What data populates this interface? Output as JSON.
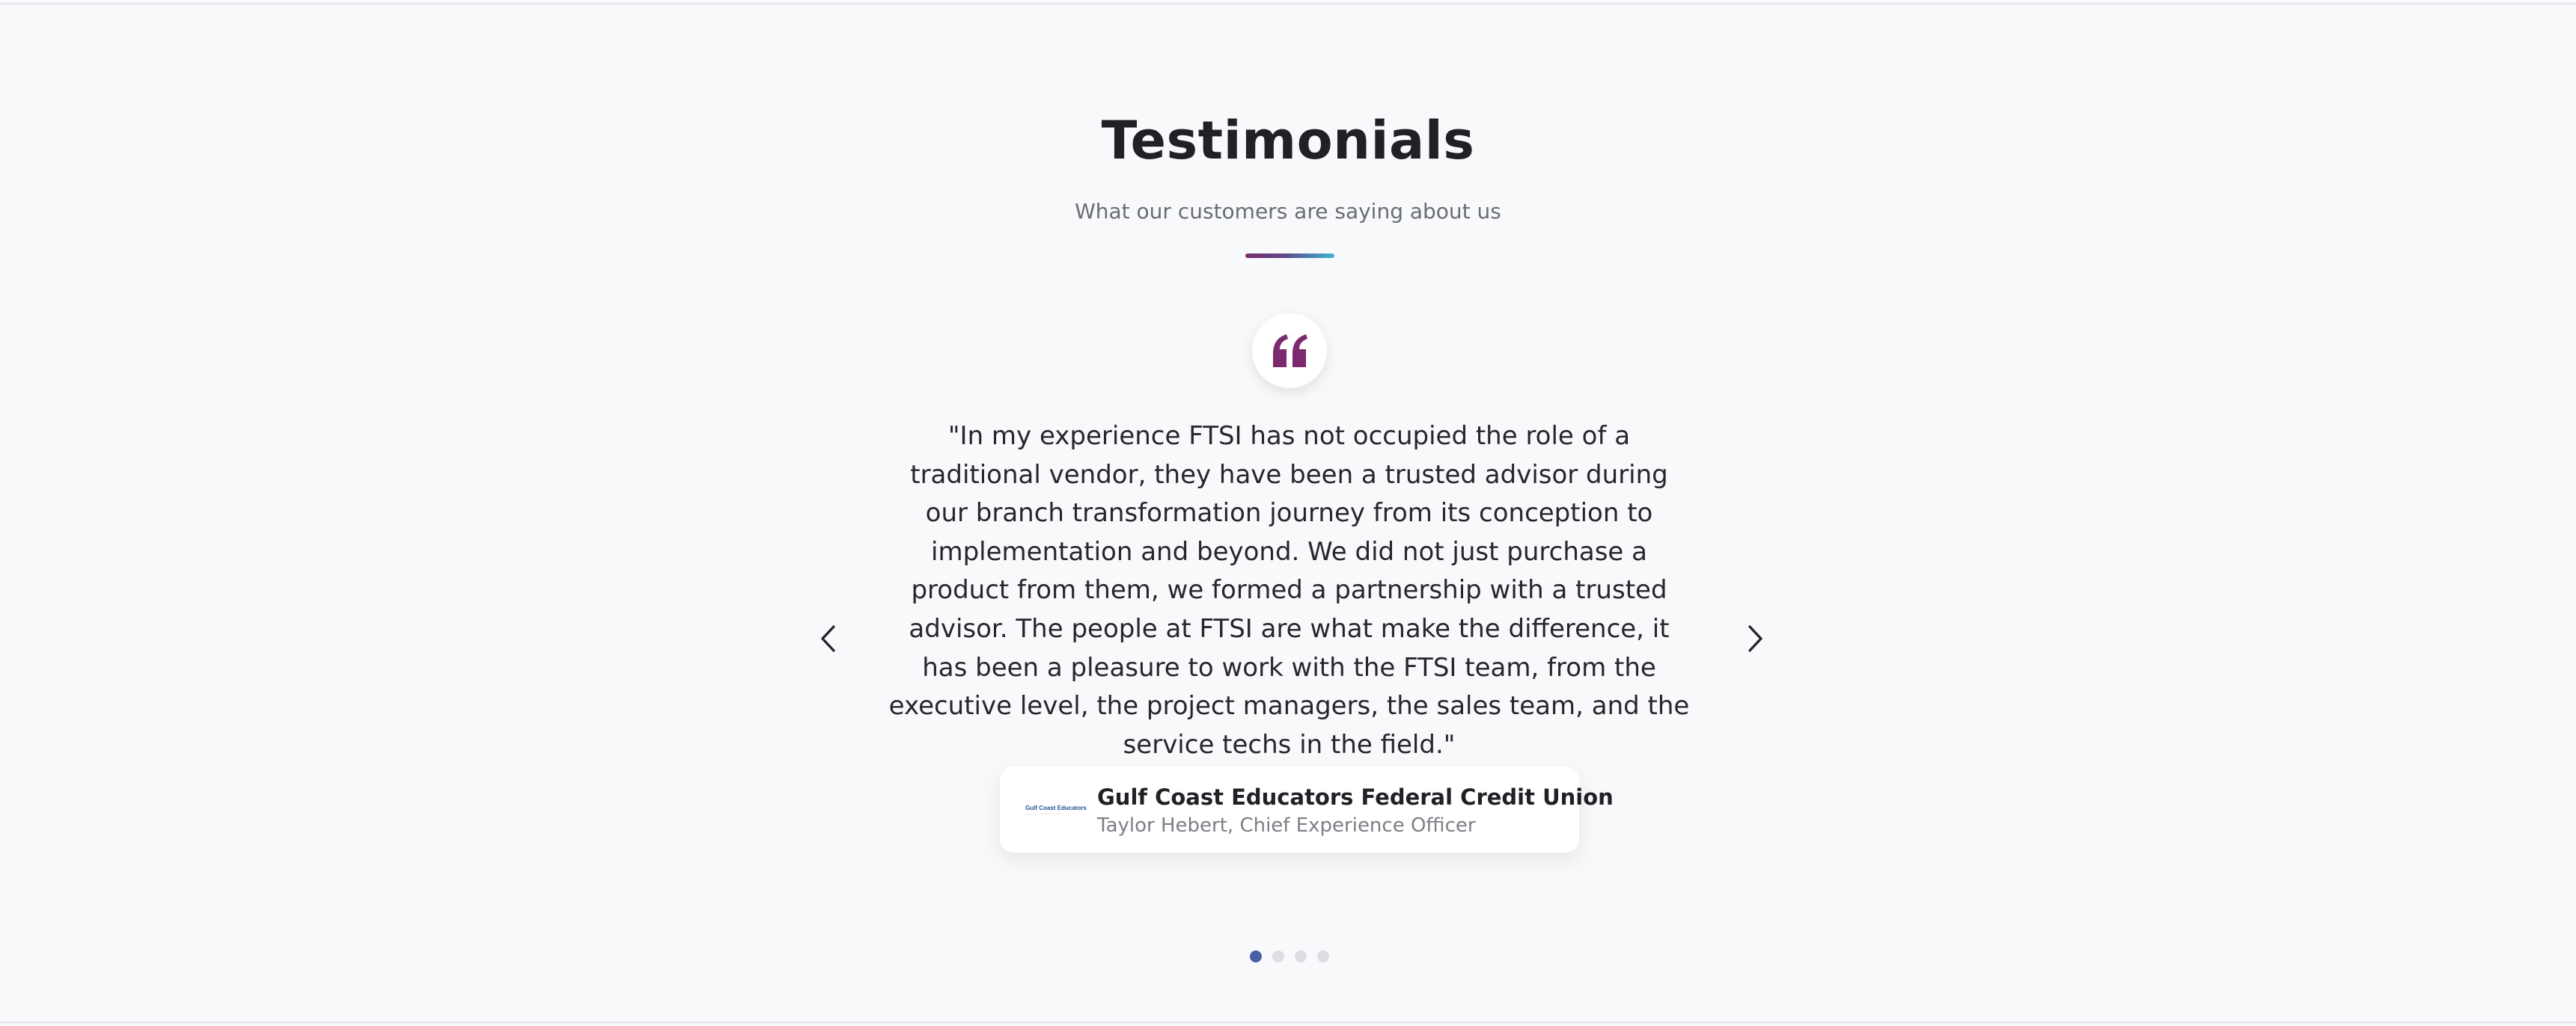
{
  "section": {
    "title": "Testimonials",
    "subtitle": "What our customers are saying about us"
  },
  "testimonial": {
    "quote": "\"In my experience FTSI has not occupied the role of a traditional vendor, they have been a trusted advisor during our branch transformation journey from its conception to implementation and beyond. We did not just purchase a product from them, we formed a partnership with a trusted advisor. The people at FTSI are what make the difference, it has been a pleasure to work with the FTSI team, from the executive level, the project managers, the sales team, and the service techs in the field.\"",
    "organization": "Gulf Coast Educators Federal Credit Union",
    "person": "Taylor Hebert, Chief Experience Officer",
    "logo_text": "Gulf Coast Educators",
    "logo_subtext": "FEDERAL CREDIT UNION"
  },
  "carousel": {
    "prev_icon": "chevron-left-icon",
    "next_icon": "chevron-right-icon",
    "slide_count": 4,
    "active_slide": 1
  },
  "colors": {
    "background": "#f8f9fb",
    "quote_icon": "#7b2a6e",
    "accent_start": "#7b2a6e",
    "accent_end": "#3fb6cf",
    "active_dot": "#4a5fa8",
    "inactive_dot": "#dcdee3"
  },
  "icons": {
    "quote": "quote-icon"
  }
}
